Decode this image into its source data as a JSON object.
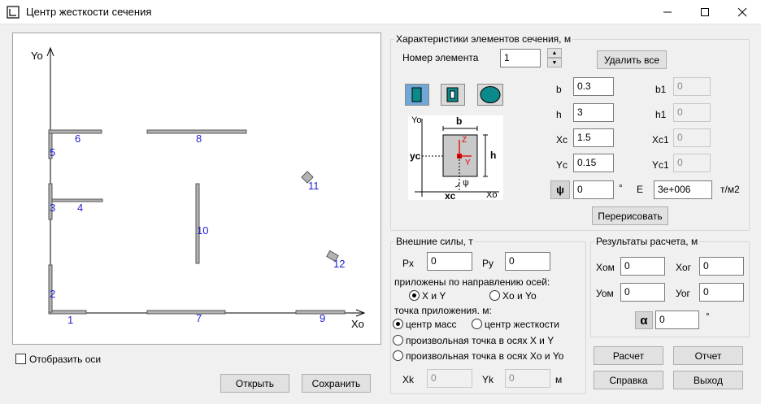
{
  "window": {
    "title": "Центр жесткости сечения",
    "minimize_icon": "minimize-icon",
    "maximize_icon": "maximize-icon",
    "close_icon": "close-icon"
  },
  "canvas": {
    "axis_y": "Yo",
    "axis_x": "Xo",
    "element_numbers": [
      "1",
      "2",
      "3",
      "4",
      "5",
      "6",
      "7",
      "8",
      "9",
      "10",
      "11",
      "12"
    ]
  },
  "show_axes": {
    "label": "Отобразить оси",
    "checked": false
  },
  "buttons": {
    "open": "Открыть",
    "save": "Сохранить",
    "delete_all": "Удалить все",
    "redraw": "Перерисовать",
    "calculate": "Расчет",
    "report": "Отчет",
    "help": "Справка",
    "exit": "Выход"
  },
  "element_props": {
    "group_title": "Характеристики элементов сечения, м",
    "element_number_label": "Номер элемента",
    "element_number": "1",
    "shape_icons": [
      "rectangle-shape-icon",
      "hollow-rectangle-shape-icon",
      "circle-shape-icon"
    ],
    "diagram": {
      "yo": "Yo",
      "xo": "Xo",
      "b": "b",
      "h": "h",
      "yc": "yc",
      "xc": "xc",
      "z": "Z",
      "y": "Y",
      "psi": "ψ"
    },
    "fields": {
      "b": {
        "label": "b",
        "value": "0.3"
      },
      "h": {
        "label": "h",
        "value": "3"
      },
      "xc": {
        "label": "Xc",
        "value": "1.5"
      },
      "yc": {
        "label": "Yc",
        "value": "0.15"
      },
      "b1": {
        "label": "b1",
        "value": "0"
      },
      "h1": {
        "label": "h1",
        "value": "0"
      },
      "xc1": {
        "label": "Xc1",
        "value": "0"
      },
      "yc1": {
        "label": "Yc1",
        "value": "0"
      },
      "psi": {
        "label": "ψ",
        "value": "0",
        "unit": "°"
      },
      "e": {
        "label": "E",
        "value": "3e+006",
        "unit": "т/м2"
      }
    }
  },
  "forces": {
    "group_title": "Внешние силы, т",
    "px_label": "Px",
    "px": "0",
    "py_label": "Py",
    "py": "0",
    "direction_label": "приложены по направлению осей:",
    "dir_options": [
      "X и Y",
      "Xo и Yo"
    ],
    "point_label": "точка приложения. м:",
    "point_options": [
      "центр масс",
      "центр жесткости",
      "произвольная точка в осях X и Y",
      "произвольная точка в осях Xo и Yo"
    ],
    "xk_label": "Xk",
    "xk": "0",
    "yk_label": "Yk",
    "yk": "0",
    "unit": "м"
  },
  "results": {
    "group_title": "Результаты расчета, м",
    "xom_label": "Xом",
    "xom": "0",
    "xog_label": "Xог",
    "xog": "0",
    "yom_label": "Уом",
    "yom": "0",
    "yog_label": "Уог",
    "yog": "0",
    "alpha_label": "α",
    "alpha": "0",
    "alpha_unit": "°"
  }
}
